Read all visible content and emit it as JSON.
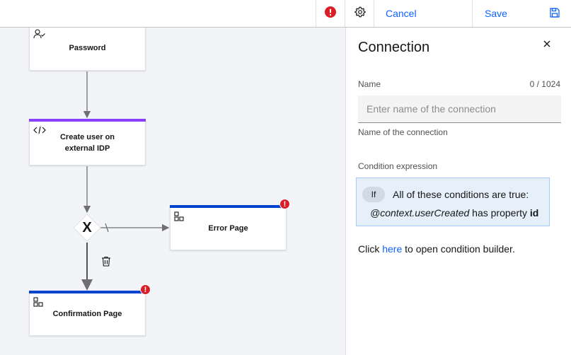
{
  "toolbar": {
    "cancel_label": "Cancel",
    "save_label": "Save",
    "error_icon": "error-filled-icon",
    "settings_icon": "gear-icon",
    "save_icon": "floppy-disk-icon"
  },
  "canvas": {
    "nodes": [
      {
        "title": "Password",
        "icon": "user-check-icon"
      },
      {
        "title_line1": "Create user on",
        "title_line2": "external IDP",
        "icon": "code-icon",
        "accent": "#8a3ffc"
      },
      {
        "title": "Error Page",
        "icon": "page-template-icon",
        "accent": "#0043ce",
        "has_error": true
      },
      {
        "title": "Confirmation Page",
        "icon": "page-template-icon",
        "accent": "#0043ce",
        "has_error": true
      }
    ],
    "gateway_label": "X",
    "error_symbol": "!",
    "delete_icon": "trash-can-icon"
  },
  "panel": {
    "title": "Connection",
    "close_icon": "close-icon",
    "name_label": "Name",
    "name_count": "0 / 1024",
    "name_value": "",
    "name_placeholder": "Enter name of the connection",
    "name_helper": "Name of the connection",
    "condition_label": "Condition expression",
    "condition": {
      "if_label": "If",
      "heading": "All of these conditions are true:",
      "subject": "@context.userCreated",
      "operator": "has property",
      "property": "id"
    },
    "builder_prefix": "Click",
    "builder_link": "here",
    "builder_suffix": "to open condition builder."
  },
  "colors": {
    "accent_blue": "#0f62fe",
    "error_red": "#da1e28",
    "purple_stripe": "#8a3ffc",
    "blue_stripe": "#0043ce"
  }
}
